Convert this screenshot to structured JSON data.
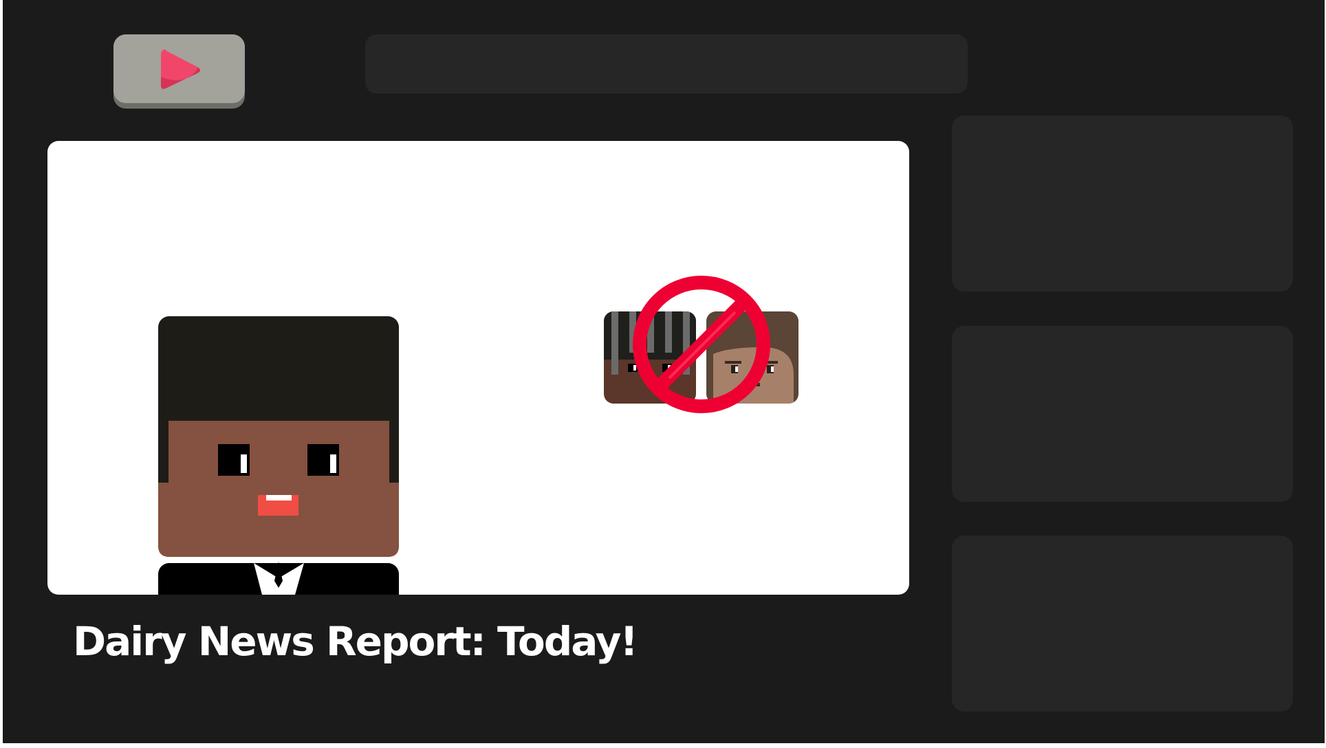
{
  "header": {
    "logo_icon": "play-icon",
    "search_value": ""
  },
  "player": {
    "scene": {
      "anchor": "news-anchor-character",
      "overlay": "no-sign-icon"
    }
  },
  "video": {
    "title": "Dairy News Report: Today!"
  },
  "sidebar": {
    "suggestion_count": 3
  },
  "colors": {
    "background": "#1b1b1b",
    "panel": "#262626",
    "logo_button": "#a3a39b",
    "play_accent": "#f0466a",
    "no_sign": "#ee0033",
    "anchor_skin": "#855140",
    "anchor_hair": "#1e1c17"
  }
}
